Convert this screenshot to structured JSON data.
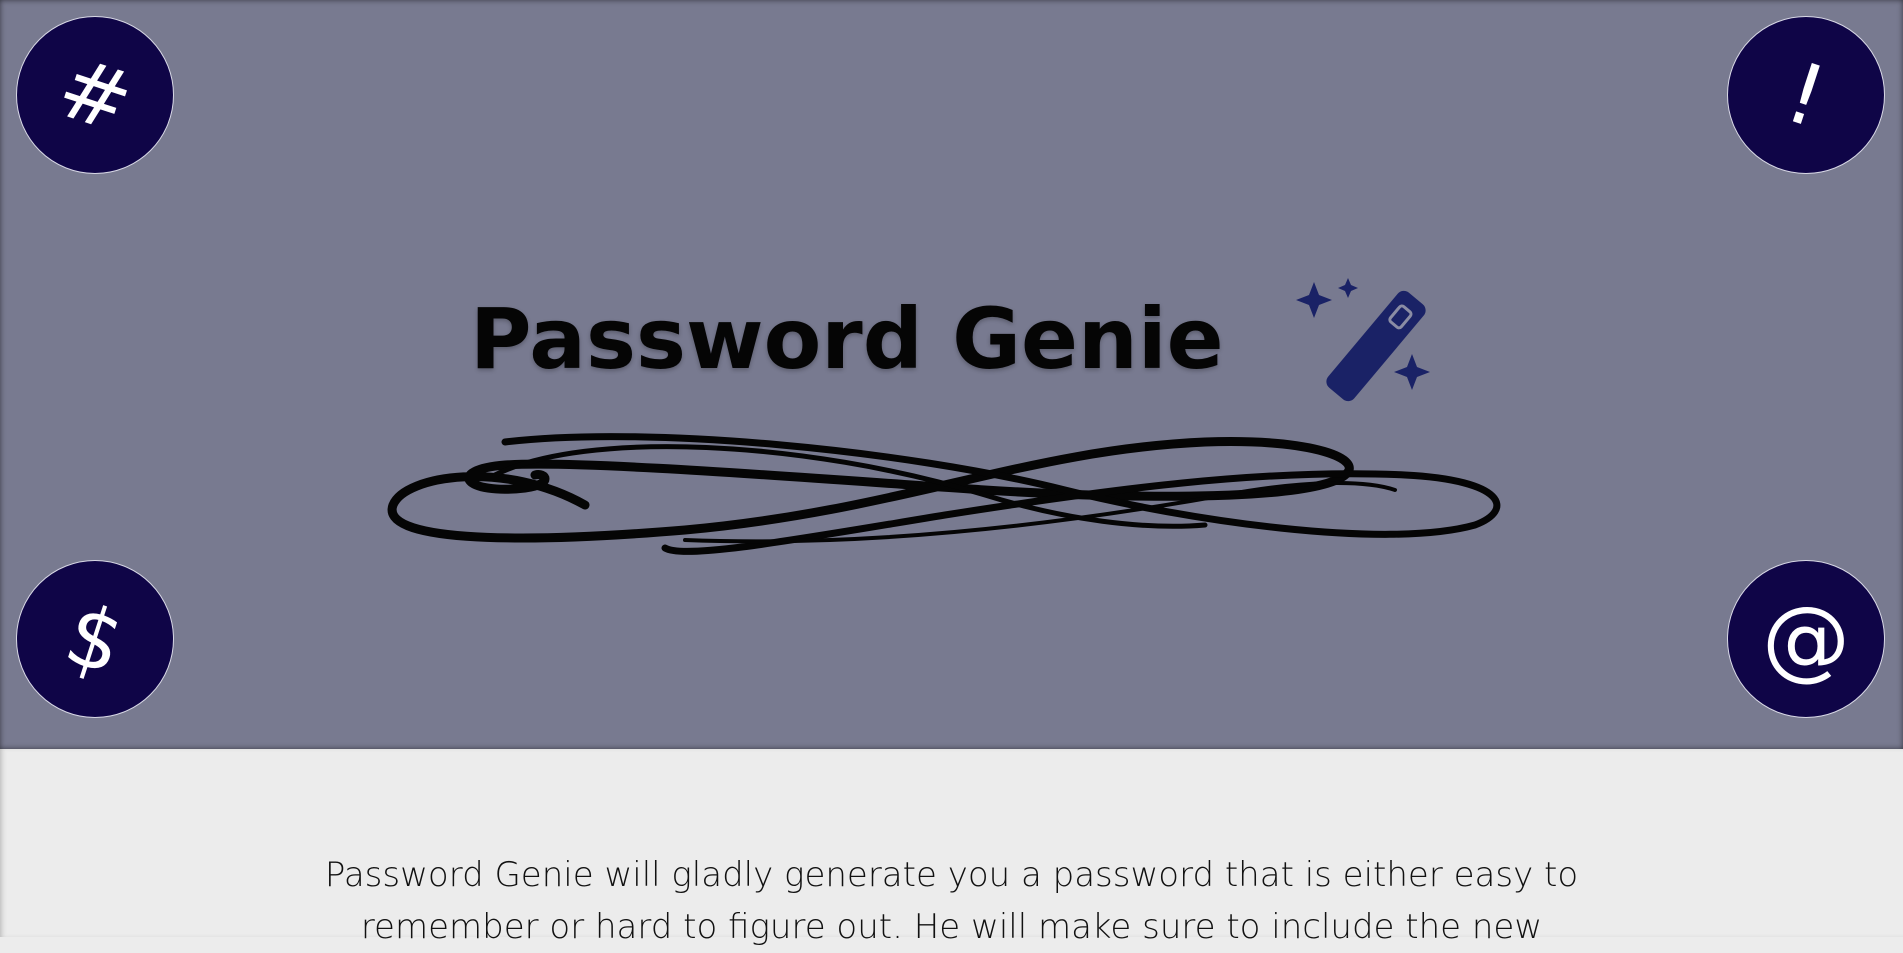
{
  "app": {
    "title": "Password Genie"
  },
  "hero": {
    "background_color": "#787a90",
    "corner_buttons": [
      {
        "symbol": "#",
        "icon": "hash-icon"
      },
      {
        "symbol": "!",
        "icon": "exclamation-icon"
      },
      {
        "symbol": "$",
        "icon": "dollar-icon"
      },
      {
        "symbol": "@",
        "icon": "at-icon"
      }
    ],
    "button_color": "#0f0547",
    "wand_color": "#1a2266"
  },
  "intro": {
    "text": "Password Genie will gladly generate you a password that is either easy to remember or hard to figure out. He will make sure to include the new"
  }
}
